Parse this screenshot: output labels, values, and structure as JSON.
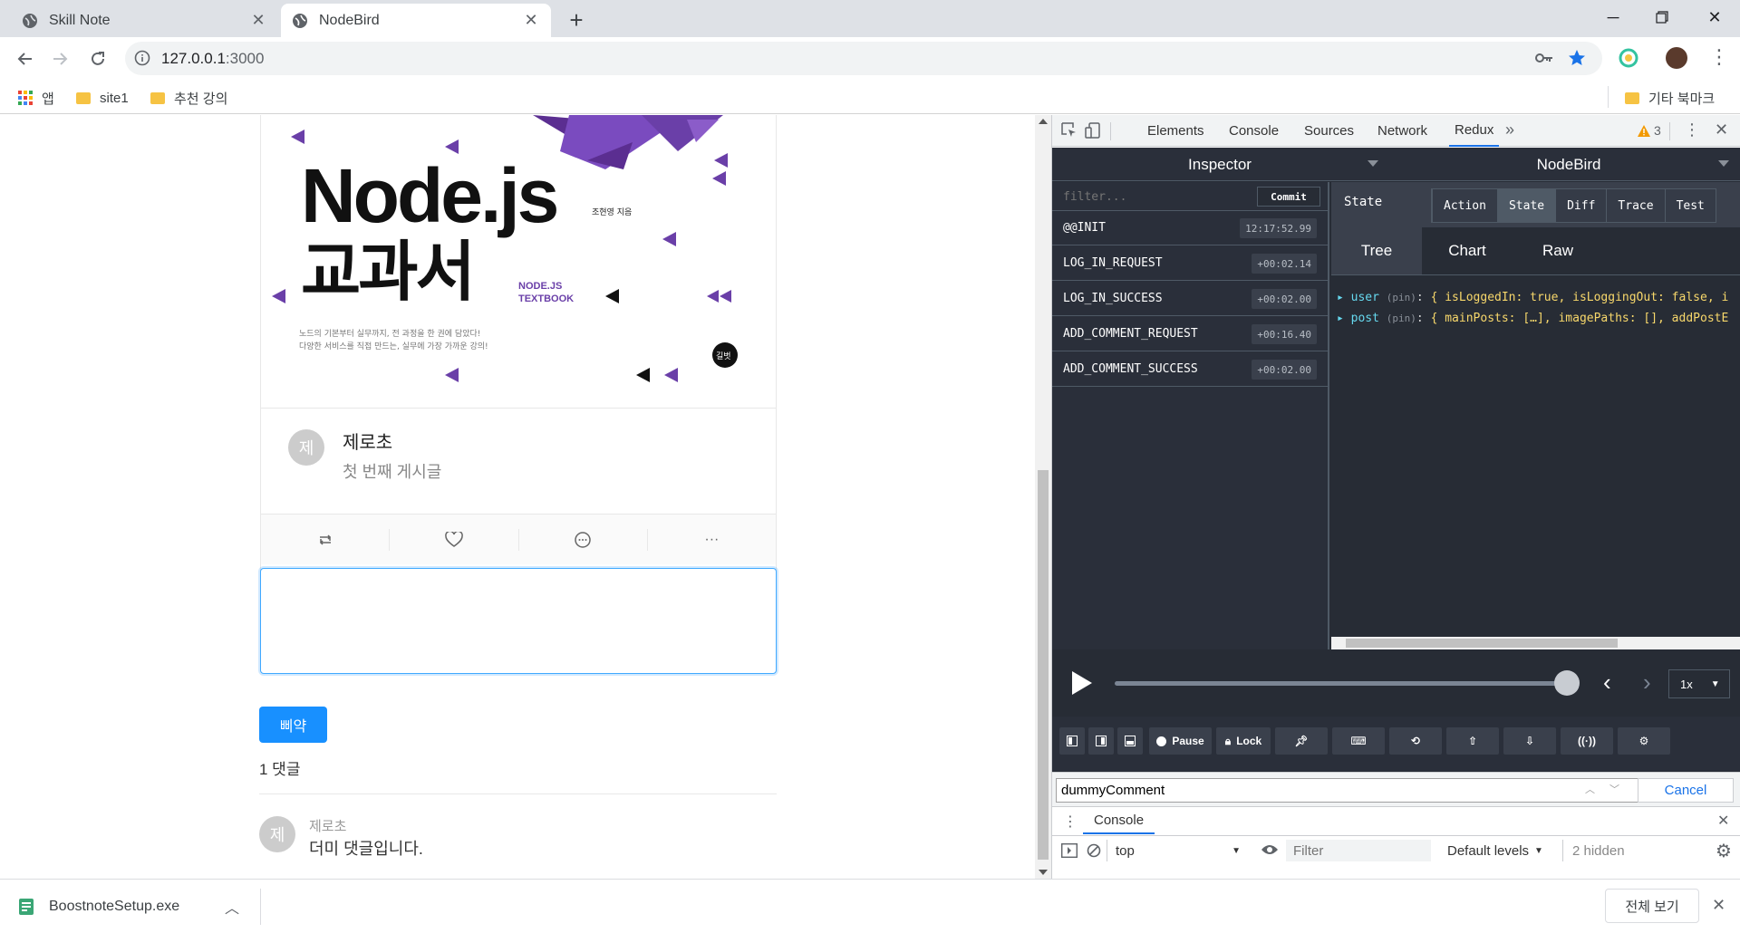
{
  "browser": {
    "tabs": [
      {
        "title": "Skill Note",
        "active": false
      },
      {
        "title": "NodeBird",
        "active": true
      }
    ],
    "url_host": "127.0.0.1",
    "url_port": ":3000",
    "bookmarks": [
      {
        "label": "앱"
      },
      {
        "label": "site1"
      },
      {
        "label": "추천 강의"
      }
    ],
    "other_bookmarks": "기타 북마크"
  },
  "post": {
    "book": {
      "title_line1": "Node.js",
      "title_line2": "교과서",
      "author": "조현영 지음",
      "subtitle_line1": "NODE.JS",
      "subtitle_line2": "TEXTBOOK",
      "desc_line1": "노드의 기본부터 실무까지, 전 과정을 한 권에 담았다!",
      "desc_line2": "다양한 서비스를 직접 만드는, 실무에 가장 가까운 강의!",
      "publisher": "길벗"
    },
    "avatar_letter": "제",
    "author": "제로초",
    "content": "첫 번째 게시글",
    "more_label": "···"
  },
  "comment_form": {
    "value": "",
    "submit_label": "삐약"
  },
  "comments": {
    "count_label": "1 댓글",
    "items": [
      {
        "avatar_letter": "제",
        "author": "제로초",
        "content": "더미 댓글입니다."
      }
    ]
  },
  "devtools": {
    "tabs": [
      "Elements",
      "Console",
      "Sources",
      "Network",
      "Redux"
    ],
    "warning_count": "3",
    "redux": {
      "inspector_label": "Inspector",
      "instance_label": "NodeBird",
      "filter_placeholder": "filter...",
      "commit_label": "Commit",
      "actions": [
        {
          "name": "@@INIT",
          "time": "12:17:52.99"
        },
        {
          "name": "LOG_IN_REQUEST",
          "time": "+00:02.14"
        },
        {
          "name": "LOG_IN_SUCCESS",
          "time": "+00:02.00"
        },
        {
          "name": "ADD_COMMENT_REQUEST",
          "time": "+00:16.40"
        },
        {
          "name": "ADD_COMMENT_SUCCESS",
          "time": "+00:02.00"
        }
      ],
      "state_label": "State",
      "mode_tabs": [
        "Action",
        "State",
        "Diff",
        "Trace",
        "Test"
      ],
      "view_tabs": [
        "Tree",
        "Chart",
        "Raw"
      ],
      "tree": [
        {
          "key": "user",
          "pin": "(pin)",
          "value": "{ isLoggedIn: true, isLoggingOut: false, i"
        },
        {
          "key": "post",
          "pin": "(pin)",
          "value": "{ mainPosts: […], imagePaths: [], addPostE"
        }
      ],
      "speed": "1x",
      "slider_position": 1.0,
      "buttons": [
        "Pause",
        "Lock"
      ]
    },
    "search": {
      "value": "dummyComment",
      "cancel_label": "Cancel"
    },
    "console": {
      "tab_label": "Console",
      "context": "top",
      "filter_placeholder": "Filter",
      "levels": "Default levels",
      "hidden": "2 hidden"
    }
  },
  "download": {
    "filename": "BoostnoteSetup.exe",
    "show_all": "전체 보기"
  },
  "colors": {
    "accent": "#1890ff",
    "redux_bg": "#272c35",
    "book_purple": "#6a3fa8"
  }
}
